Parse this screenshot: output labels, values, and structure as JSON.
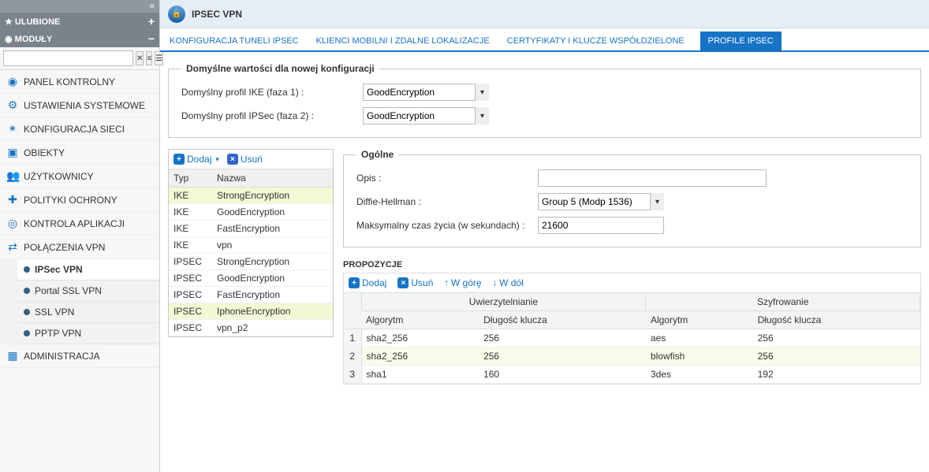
{
  "sidebar": {
    "fav_header": "ULUBIONE",
    "mod_header": "MODUŁY",
    "search_placeholder": "",
    "items": [
      {
        "icon": "◉",
        "label": "PANEL KONTROLNY"
      },
      {
        "icon": "⚙",
        "label": "USTAWIENIA SYSTEMOWE"
      },
      {
        "icon": "✴",
        "label": "KONFIGURACJA SIECI"
      },
      {
        "icon": "▣",
        "label": "OBIEKTY"
      },
      {
        "icon": "👥",
        "label": "UŻYTKOWNICY"
      },
      {
        "icon": "✚",
        "label": "POLITYKI OCHRONY"
      },
      {
        "icon": "◎",
        "label": "KONTROLA APLIKACJI"
      },
      {
        "icon": "⇄",
        "label": "POŁĄCZENIA VPN"
      }
    ],
    "vpn_sub": [
      "IPSec VPN",
      "Portal SSL VPN",
      "SSL VPN",
      "PPTP VPN"
    ],
    "admin": {
      "icon": "▦",
      "label": "ADMINISTRACJA"
    },
    "selected_sub": 0
  },
  "page": {
    "title": "IPSEC VPN",
    "tabs": [
      "KONFIGURACJA TUNELI IPSEC",
      "KLIENCI MOBILNI I ZDALNE LOKALIZACJE",
      "CERTYFIKATY I KLUCZE WSPÓŁDZIELONE",
      "PROFILE IPSEC"
    ],
    "active_tab": 3
  },
  "defaults": {
    "legend": "Domyślne wartości dla nowej konfiguracji",
    "ike_label": "Domyślny profil IKE (faza 1) :",
    "ike_value": "GoodEncryption",
    "ipsec_label": "Domyślny profil IPSec (faza 2) :",
    "ipsec_value": "GoodEncryption"
  },
  "profile_toolbar": {
    "add": "Dodaj",
    "del": "Usuń"
  },
  "profile_cols": {
    "type": "Typ",
    "name": "Nazwa"
  },
  "profiles": [
    {
      "type": "IKE",
      "name": "StrongEncryption",
      "sel": true
    },
    {
      "type": "IKE",
      "name": "GoodEncryption"
    },
    {
      "type": "IKE",
      "name": "FastEncryption"
    },
    {
      "type": "IKE",
      "name": "vpn"
    },
    {
      "type": "IPSEC",
      "name": "StrongEncryption"
    },
    {
      "type": "IPSEC",
      "name": "GoodEncryption"
    },
    {
      "type": "IPSEC",
      "name": "FastEncryption"
    },
    {
      "type": "IPSEC",
      "name": "IphoneEncryption",
      "sel": true
    },
    {
      "type": "IPSEC",
      "name": "vpn_p2"
    }
  ],
  "general": {
    "legend": "Ogólne",
    "desc_label": "Opis :",
    "desc_value": "",
    "dh_label": "Diffie-Hellman :",
    "dh_value": "Group 5 (Modp 1536)",
    "life_label": "Maksymalny czas życia (w sekundach) :",
    "life_value": "21600"
  },
  "proposals": {
    "heading": "PROPOZYCJE",
    "toolbar": {
      "add": "Dodaj",
      "del": "Usuń",
      "up": "W górę",
      "down": "W dół"
    },
    "group_auth": "Uwierzytelnianie",
    "group_enc": "Szyfrowanie",
    "col_alg": "Algorytm",
    "col_key": "Długość klucza",
    "rows": [
      {
        "aalg": "sha2_256",
        "akey": "256",
        "ealg": "aes",
        "ekey": "256"
      },
      {
        "aalg": "sha2_256",
        "akey": "256",
        "ealg": "blowfish",
        "ekey": "256",
        "sel": true
      },
      {
        "aalg": "sha1",
        "akey": "160",
        "ealg": "3des",
        "ekey": "192"
      }
    ]
  }
}
